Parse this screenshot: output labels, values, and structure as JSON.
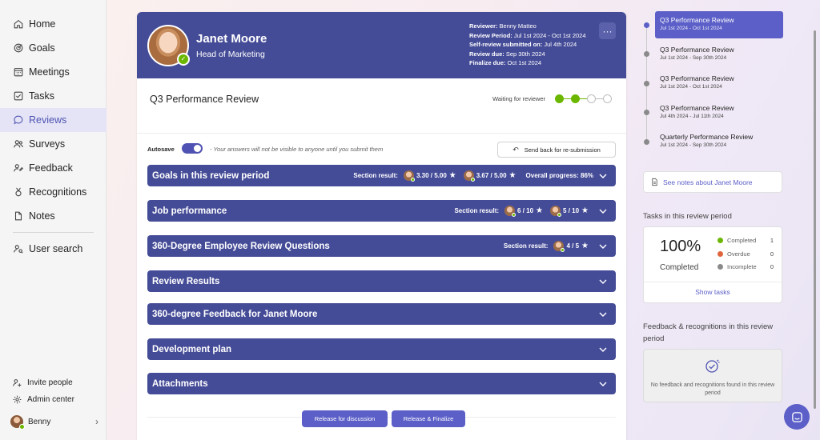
{
  "sidebar": {
    "items": [
      {
        "label": "Home",
        "icon": "home-icon"
      },
      {
        "label": "Goals",
        "icon": "target-icon"
      },
      {
        "label": "Meetings",
        "icon": "calendar-icon"
      },
      {
        "label": "Tasks",
        "icon": "checkbox-icon"
      },
      {
        "label": "Reviews",
        "icon": "chat-bubble-icon",
        "active": true
      },
      {
        "label": "Surveys",
        "icon": "people-icon"
      },
      {
        "label": "Feedback",
        "icon": "person-feedback-icon"
      },
      {
        "label": "Recognitions",
        "icon": "ribbon-icon"
      },
      {
        "label": "Notes",
        "icon": "document-icon"
      },
      {
        "label": "User search",
        "icon": "person-search-icon"
      }
    ],
    "invite": "Invite people",
    "admin": "Admin center",
    "user": "Benny"
  },
  "header": {
    "name": "Janet Moore",
    "role": "Head of Marketing",
    "meta": [
      {
        "label": "Reviewer:",
        "value": "Benny Matteo"
      },
      {
        "label": "Review Period:",
        "value": "Jul 1st 2024 - Oct 1st 2024"
      },
      {
        "label": "Self-review submitted on:",
        "value": "Jul 4th 2024"
      },
      {
        "label": "Review due:",
        "value": "Sep 30th 2024"
      },
      {
        "label": "Finalize due:",
        "value": "Oct 1st 2024"
      }
    ],
    "more": "···"
  },
  "review": {
    "title": "Q3 Performance Review",
    "status": "Waiting for reviewer",
    "steps_done": 2,
    "steps_total": 4
  },
  "autosave": {
    "label": "Autosave",
    "note": "- Your answers will not be visible to anyone until you submit them",
    "resubmit": "Send back for re-submission"
  },
  "sections": [
    {
      "title": "Goals in this review period",
      "result_label": "Section result:",
      "scores": [
        "3.30 / 5.00",
        "3.67 / 5.00"
      ],
      "progress": "Overall progress: 86%"
    },
    {
      "title": "Job performance",
      "result_label": "Section result:",
      "scores": [
        "6 / 10",
        "5 / 10"
      ]
    },
    {
      "title": "360-Degree Employee Review Questions",
      "result_label": "Section result:",
      "scores": [
        "4 / 5"
      ]
    },
    {
      "title": "Review Results"
    },
    {
      "title": "360-degree Feedback for Janet Moore"
    },
    {
      "title": "Development plan"
    },
    {
      "title": "Attachments"
    }
  ],
  "actions": {
    "release_discussion": "Release for discussion",
    "release_finalize": "Release & Finalize"
  },
  "timeline": [
    {
      "name": "Q3 Performance Review",
      "dates": "Jul 1st 2024 - Oct 1st 2024",
      "active": true
    },
    {
      "name": "Q3 Performance Review",
      "dates": "Jul 1st 2024 - Sep 30th 2024"
    },
    {
      "name": "Q3 Performance Review",
      "dates": "Jul 1st 2024 - Oct 1st 2024"
    },
    {
      "name": "Q3 Performance Review",
      "dates": "Jul 4th 2024 - Jul 11th 2024"
    },
    {
      "name": "Quarterly Performance Review",
      "dates": "Jul 1st 2024 - Sep 30th 2024"
    }
  ],
  "notes_link": "See notes about Janet Moore",
  "tasks": {
    "heading": "Tasks in this review period",
    "percent": "100%",
    "percent_label": "Completed",
    "legend": [
      {
        "label": "Completed",
        "value": "1",
        "color": "#6bb700"
      },
      {
        "label": "Overdue",
        "value": "0",
        "color": "#e0643c"
      },
      {
        "label": "Incomplete",
        "value": "0",
        "color": "#8a8a8a"
      }
    ],
    "show": "Show tasks"
  },
  "feedback": {
    "heading": "Feedback & recognitions in this review period",
    "empty": "No feedback and recognitions found in this review period"
  },
  "colors": {
    "accent": "#5b5fc7",
    "header": "#454c97",
    "success": "#6bb700"
  }
}
